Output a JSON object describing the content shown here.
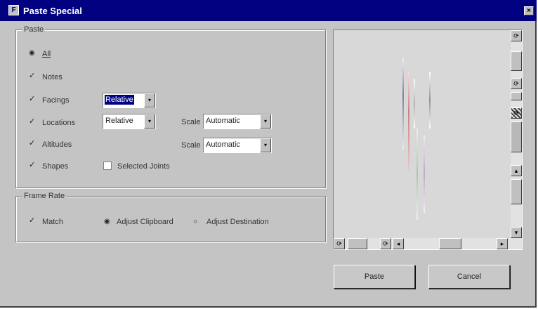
{
  "window": {
    "title": "Paste Special",
    "close_glyph": "×",
    "app_icon": "app-icon"
  },
  "paste_group": {
    "legend": "Paste",
    "all": {
      "label": "All",
      "selected": true
    },
    "notes": {
      "label": "Notes",
      "checked": true
    },
    "facings": {
      "label": "Facings",
      "checked": true,
      "value": "Relative"
    },
    "locations": {
      "label": "Locations",
      "checked": true,
      "value": "Relative",
      "scale_label": "Scale",
      "scale_value": "Automatic"
    },
    "altitudes": {
      "label": "Altitudes",
      "checked": true,
      "scale_label": "Scale",
      "scale_value": "Automatic"
    },
    "shapes": {
      "label": "Shapes",
      "checked": true
    },
    "selected_joints": {
      "label": "Selected Joints",
      "checked": false
    }
  },
  "frame_rate_group": {
    "legend": "Frame Rate",
    "match": {
      "label": "Match",
      "checked": true
    },
    "adjust_clipboard": {
      "label": "Adjust Clipboard",
      "selected": true
    },
    "adjust_destination": {
      "label": "Adjust Destination",
      "selected": false
    }
  },
  "buttons": {
    "paste": "Paste",
    "cancel": "Cancel"
  },
  "glyphs": {
    "check": "✓",
    "radio_on": "◉",
    "radio_off": "○",
    "arrow_down": "▾",
    "arrow_up": "▴",
    "arrow_left": "◂",
    "arrow_right": "▸",
    "rotate": "⟳"
  },
  "colors": {
    "titlebar": "#000080",
    "face": "#c4c4c4",
    "preview_bg": "#d8d8d8",
    "selection": "#000080"
  }
}
